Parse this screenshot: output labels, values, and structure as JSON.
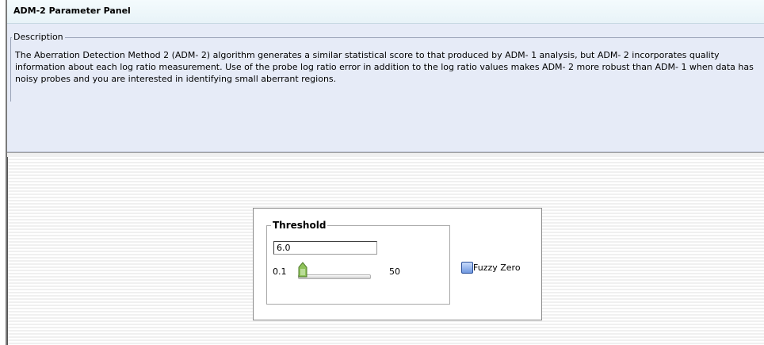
{
  "panel": {
    "title": "ADM-2 Parameter Panel"
  },
  "description": {
    "legend": "Description",
    "text": "The Aberration Detection Method 2 (ADM- 2) algorithm generates a similar statistical score to that produced by ADM- 1 analysis, but ADM- 2 incorporates quality information about each log ratio measurement. Use of the probe log ratio error in addition to the log ratio values makes ADM- 2 more robust than ADM- 1 when data has noisy probes and you are interested in identifying small aberrant regions."
  },
  "threshold": {
    "legend": "Threshold",
    "value": "6.0",
    "min_label": "0.1",
    "max_label": "50",
    "slider_fraction": 0.12
  },
  "fuzzy_zero": {
    "label": "Fuzzy Zero",
    "checked": false
  },
  "colors": {
    "title_bg": "#e8f3f8",
    "description_bg": "#e6ebf7",
    "checkbox_blue": "#6f98e0",
    "slider_thumb_green": "#8fc25a"
  },
  "icons": {
    "slider_thumb": "slider-thumb-icon"
  }
}
